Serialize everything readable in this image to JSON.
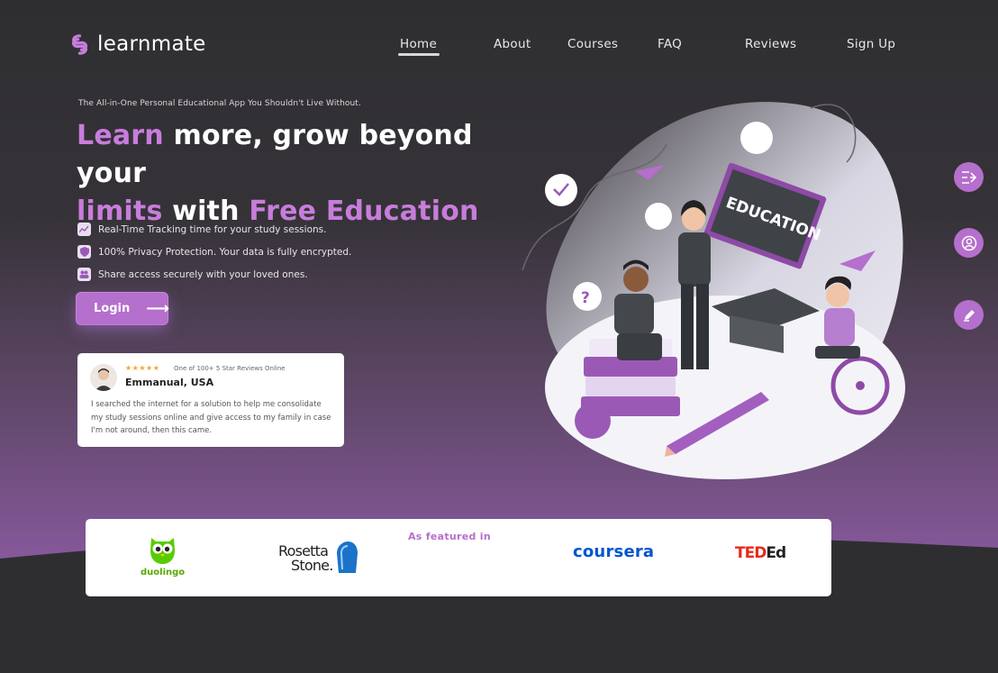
{
  "brand": {
    "name": "learnmate"
  },
  "nav": {
    "items": [
      {
        "label": "Home",
        "active": true
      },
      {
        "label": "About"
      },
      {
        "label": "Courses"
      },
      {
        "label": "FAQ"
      },
      {
        "label": "Reviews"
      },
      {
        "label": "Sign Up"
      }
    ]
  },
  "hero": {
    "tagline": "The All-in-One Personal Educational App You Shouldn't Live Without.",
    "headline": {
      "w1": "Learn",
      "w2": " more, grow beyond your",
      "w3": "limits",
      "w4": " with ",
      "w5": "Free Education"
    },
    "features": [
      {
        "icon": "chart-icon",
        "text": "Real-Time Tracking time for your study sessions."
      },
      {
        "icon": "shield-icon",
        "text": "100% Privacy Protection. Your data is fully encrypted."
      },
      {
        "icon": "users-icon",
        "text": "Share access securely with your loved ones."
      }
    ],
    "login_label": "Login"
  },
  "review": {
    "stars": "★★★★★",
    "meta": "One of 100+ 5 Star Reviews Online",
    "name": "Emmanual, USA",
    "text": "I searched the internet for a solution to help me consolidate my study sessions online and give access to my family in case I'm not around, then this came."
  },
  "illustration": {
    "board_text": "EDUCATION"
  },
  "side_buttons": [
    "menu-arrow-icon",
    "user-icon",
    "pencil-icon"
  ],
  "featured": {
    "title": "As featured in",
    "brands": {
      "duolingo": "duolingo",
      "rosetta_1": "Rosetta",
      "rosetta_2": "Stone.",
      "coursera": "coursera",
      "ted_1": "TED",
      "ted_2": "Ed"
    }
  },
  "colors": {
    "accent": "#b56fcc",
    "headline_purple": "#c77ddb",
    "background": "#2e2e31"
  }
}
